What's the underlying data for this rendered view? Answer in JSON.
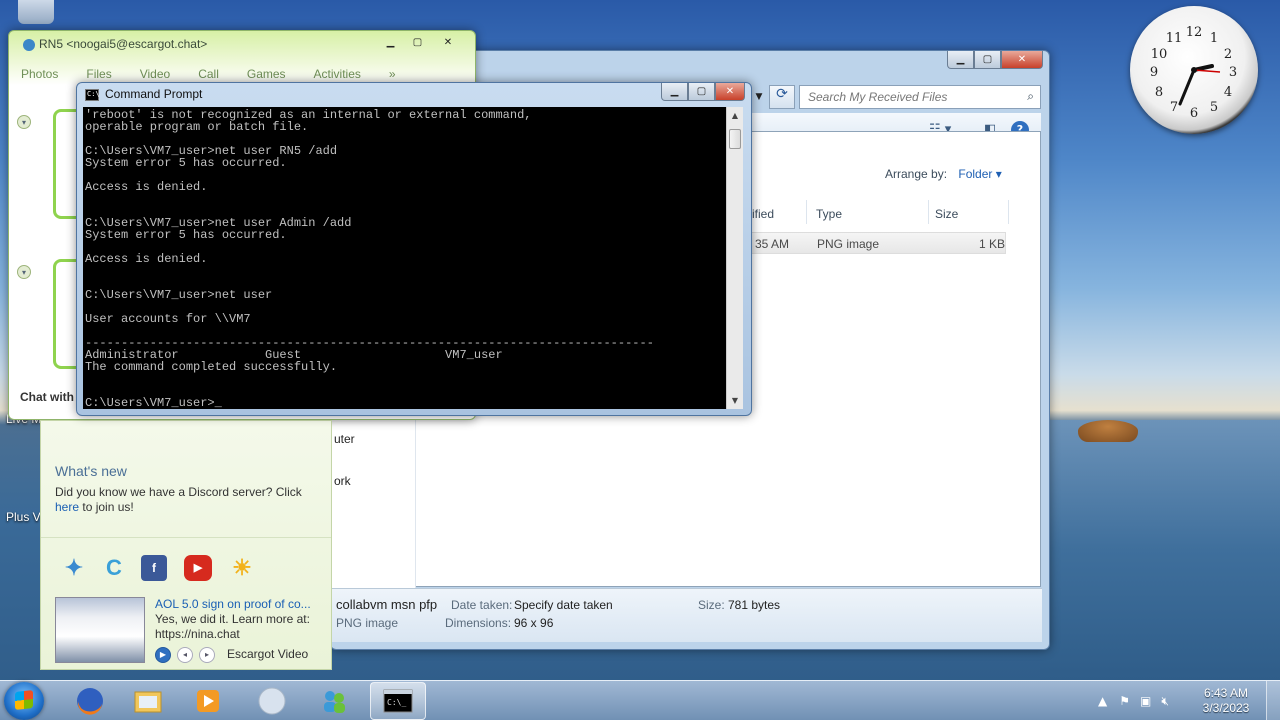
{
  "messenger": {
    "title": "RN5 <noogai5@escargot.chat>",
    "tabs": [
      "Photos",
      "Files",
      "Video",
      "Call",
      "Games",
      "Activities"
    ],
    "more": "»",
    "chat_with": "Chat with"
  },
  "whats_new": {
    "heading": "What's new",
    "text_prefix": "Did you know we have a Discord server? Click ",
    "link": "here",
    "text_suffix": " to join us!",
    "video_title": "AOL 5.0 sign on proof of co...",
    "video_desc": "Yes, we did it. Learn more at: https://nina.chat",
    "video_source": "Escargot Video"
  },
  "explorer": {
    "search_placeholder": "Search My Received Files",
    "arrange_label": "Arrange by:",
    "arrange_value": "Folder",
    "columns": [
      "ified",
      "Type",
      "Size"
    ],
    "row": {
      "date": "35 AM",
      "type": "PNG image",
      "size": "1 KB"
    },
    "nav_items": [
      "uter",
      "ork"
    ],
    "details": {
      "name": "collabvm msn pfp",
      "kind": "PNG image",
      "date_label": "Date taken:",
      "date_value": "Specify date taken",
      "dim_label": "Dimensions:",
      "dim_value": "96 x 96",
      "size_label": "Size:",
      "size_value": "781 bytes"
    }
  },
  "cmd": {
    "title": "Command Prompt",
    "output": "'reboot' is not recognized as an internal or external command,\noperable program or batch file.\n\nC:\\Users\\VM7_user>net user RN5 /add\nSystem error 5 has occurred.\n\nAccess is denied.\n\n\nC:\\Users\\VM7_user>net user Admin /add\nSystem error 5 has occurred.\n\nAccess is denied.\n\n\nC:\\Users\\VM7_user>net user\n\nUser accounts for \\\\VM7\n\n-------------------------------------------------------------------------------\nAdministrator            Guest                    VM7_user\nThe command completed successfully.\n\n\nC:\\Users\\VM7_user>_"
  },
  "desktop": {
    "icon_live": "Live M",
    "icon_plus": "Plus V"
  },
  "taskbar": {
    "time": "6:43 AM",
    "date": "3/3/2023"
  },
  "icons": {
    "start": "windows-orb",
    "apps": [
      "firefox",
      "explorer",
      "media-player",
      "orb",
      "messenger",
      "cmd"
    ]
  }
}
